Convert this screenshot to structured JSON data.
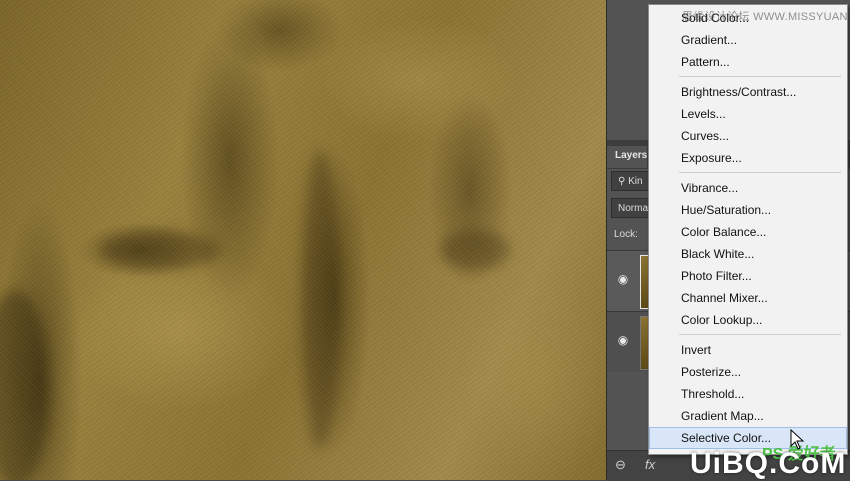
{
  "layers_panel": {
    "title": "Layers",
    "kind_filter": "Kin",
    "blend_mode": "Norma",
    "lock_label": "Lock:",
    "footer": {
      "link_icon": "⊖",
      "fx_label": "fx"
    }
  },
  "adjustment_menu": {
    "groups": [
      [
        "Solid Color...",
        "Gradient...",
        "Pattern..."
      ],
      [
        "Brightness/Contrast...",
        "Levels...",
        "Curves...",
        "Exposure..."
      ],
      [
        "Vibrance...",
        "Hue/Saturation...",
        "Color Balance...",
        "Black  White...",
        "Photo Filter...",
        "Channel Mixer...",
        "Color Lookup..."
      ],
      [
        "Invert",
        "Posterize...",
        "Threshold...",
        "Gradient Map...",
        "Selective Color..."
      ]
    ],
    "highlighted": "Selective Color..."
  },
  "watermarks": {
    "top": "思缘设计论坛  WWW.MISSYUAN.COM",
    "bottom": "UiBQ.CoM",
    "ps_badge": "PS 爱好者"
  },
  "colors": {
    "menu_bg": "#f2f2f2",
    "highlight_bg": "#d9e6f7",
    "panel_bg": "#535353",
    "canvas_tone": "#8a7232"
  }
}
